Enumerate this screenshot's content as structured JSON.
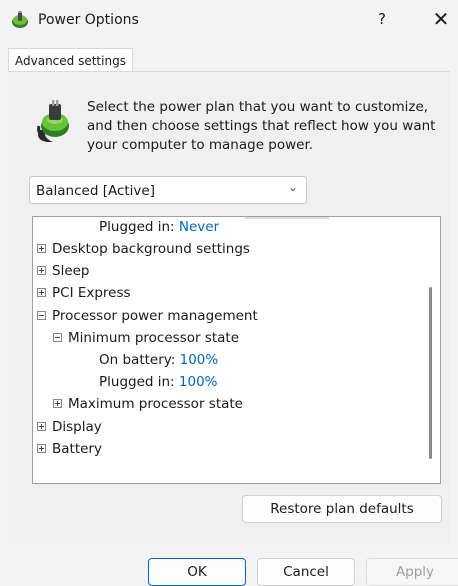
{
  "window": {
    "title": "Power Options",
    "help_label": "?",
    "close_label": "✕"
  },
  "tabs": [
    {
      "label": "Advanced settings",
      "active": true
    }
  ],
  "description": "Select the power plan that you want to customize, and then choose settings that reflect how you want your computer to manage power.",
  "plan_select": {
    "value": "Balanced [Active]"
  },
  "tree": {
    "rows": [
      {
        "label": "Plugged in: ",
        "value": "Never",
        "toggle": "none"
      },
      {
        "label": "Desktop background settings",
        "toggle": "plus"
      },
      {
        "label": "Sleep",
        "toggle": "plus"
      },
      {
        "label": "PCI Express",
        "toggle": "plus"
      },
      {
        "label": "Processor power management",
        "toggle": "minus"
      },
      {
        "label": "Minimum processor state",
        "toggle": "minus"
      },
      {
        "label": "On battery: ",
        "value": "100%",
        "toggle": "none"
      },
      {
        "label": "Plugged in: ",
        "value": "100%",
        "toggle": "none"
      },
      {
        "label": "Maximum processor state",
        "toggle": "plus"
      },
      {
        "label": "Display",
        "toggle": "plus"
      },
      {
        "label": "Battery",
        "toggle": "plus"
      }
    ]
  },
  "buttons": {
    "restore": "Restore plan defaults",
    "ok": "OK",
    "cancel": "Cancel",
    "apply": "Apply"
  },
  "colors": {
    "value_link": "#0067c0",
    "accent": "#0067c0"
  }
}
